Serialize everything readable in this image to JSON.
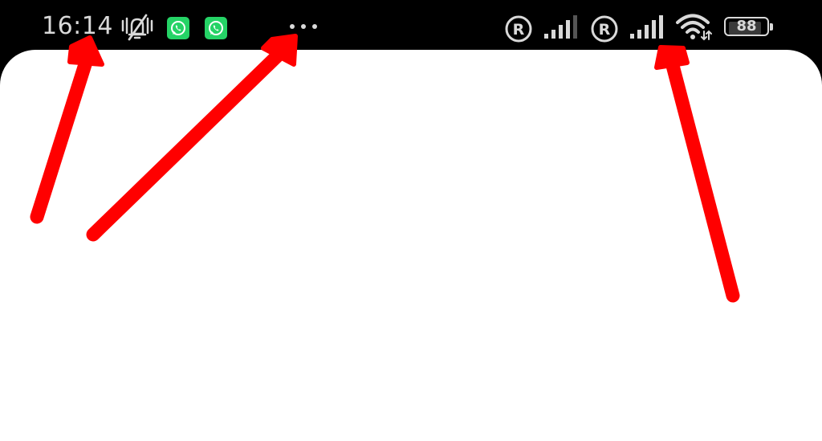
{
  "status_bar": {
    "time": "16:14",
    "notification_icons": [
      "mute-vibrate-icon",
      "whatsapp-icon",
      "whatsapp-icon"
    ],
    "more_indicator": "more-dots-icon",
    "sim1": {
      "roaming_label": "R",
      "signal_bars": 4
    },
    "sim2": {
      "roaming_label": "R",
      "signal_bars": 5
    },
    "wifi": "wifi-icon",
    "battery_level": "88"
  },
  "colors": {
    "status_bar_bg": "#000000",
    "status_text": "#d9d9d9",
    "whatsapp_green": "#25d366",
    "annotation_arrow": "#ff0000",
    "content_bg": "#ffffff"
  },
  "annotations": {
    "arrow_count": 3,
    "arrow_targets": [
      "time",
      "more-dots",
      "signal-sim2"
    ]
  }
}
